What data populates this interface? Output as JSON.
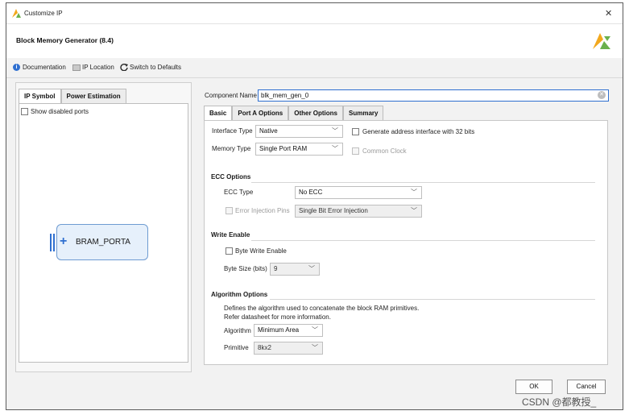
{
  "window": {
    "title": "Customize IP"
  },
  "header": {
    "title": "Block Memory Generator (8.4)"
  },
  "toolbar": {
    "documentation": "Documentation",
    "ip_location": "IP Location",
    "switch_defaults": "Switch to Defaults"
  },
  "left_tabs": [
    "IP Symbol",
    "Power Estimation"
  ],
  "show_disabled_ports": "Show disabled ports",
  "symbol": {
    "port_label": "BRAM_PORTA"
  },
  "component": {
    "label": "Component Name",
    "value": "blk_mem_gen_0"
  },
  "right_tabs": [
    "Basic",
    "Port A Options",
    "Other Options",
    "Summary"
  ],
  "basic": {
    "interface_type_label": "Interface Type",
    "interface_type_value": "Native",
    "gen_address_label": "Generate address interface with 32 bits",
    "memory_type_label": "Memory Type",
    "memory_type_value": "Single Port RAM",
    "common_clock_label": "Common Clock"
  },
  "ecc": {
    "title": "ECC Options",
    "type_label": "ECC Type",
    "type_value": "No ECC",
    "error_injection_label": "Error Injection Pins",
    "error_injection_value": "Single Bit Error Injection"
  },
  "write_enable": {
    "title": "Write Enable",
    "byte_write_label": "Byte Write Enable",
    "byte_size_label": "Byte Size (bits)",
    "byte_size_value": "9"
  },
  "algorithm": {
    "title": "Algorithm Options",
    "desc1": "Defines the algorithm used to concatenate the block RAM primitives.",
    "desc2": "Refer datasheet for more information.",
    "algorithm_label": "Algorithm",
    "algorithm_value": "Minimum Area",
    "primitive_label": "Primitive",
    "primitive_value": "8kx2"
  },
  "buttons": {
    "ok": "OK",
    "cancel": "Cancel"
  },
  "watermark": "CSDN @都教授_",
  "colors": {
    "accent_blue": "#2f6fd0",
    "logo_green": "#6ab04c",
    "logo_yellow": "#f2a81d"
  }
}
